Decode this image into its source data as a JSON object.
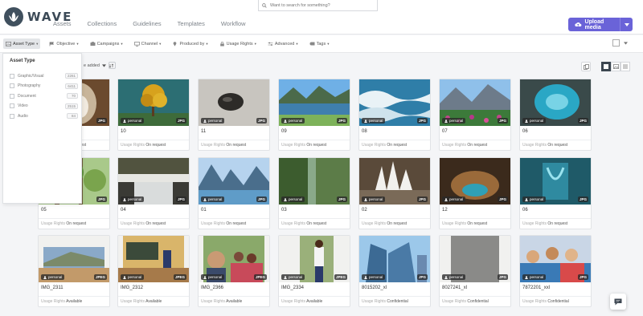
{
  "app": {
    "logo_text": "WAVE"
  },
  "nav": [
    "Assets",
    "Collections",
    "Guidelines",
    "Templates",
    "Workflow"
  ],
  "search": {
    "placeholder": "Want to search for something?"
  },
  "upload": {
    "label": "Upload media",
    "color": "#6a63d8"
  },
  "filters": [
    {
      "label": "Asset Type",
      "icon": "image-icon",
      "active": true
    },
    {
      "label": "Objective",
      "icon": "flag-icon"
    },
    {
      "label": "Campaigns",
      "icon": "campaign-icon"
    },
    {
      "label": "Channel",
      "icon": "monitor-icon"
    },
    {
      "label": "Produced by",
      "icon": "pin-icon"
    },
    {
      "label": "Usage Rights",
      "icon": "lock-icon"
    },
    {
      "label": "Advanced",
      "icon": "sliders-icon"
    },
    {
      "label": "Tags",
      "icon": "tag-icon"
    }
  ],
  "sort": {
    "label": "e added"
  },
  "asset_type_dropdown": {
    "title": "Asset Type",
    "items": [
      {
        "label": "Graphic/Visual",
        "count": "2261"
      },
      {
        "label": "Photography",
        "count": "6411"
      },
      {
        "label": "Document",
        "count": "70"
      },
      {
        "label": "Video",
        "count": "2515"
      },
      {
        "label": "Audio",
        "count": "84"
      }
    ]
  },
  "rights_label": "Usage Rights",
  "tag_label": "personal",
  "assets": [
    {
      "name": "",
      "format": "JPG",
      "rights": "On request",
      "thumb": "cave",
      "hidden": true
    },
    {
      "name": "10",
      "format": "JPG",
      "rights": "On request",
      "thumb": "tree"
    },
    {
      "name": "11",
      "format": "JPG",
      "rights": "On request",
      "thumb": "rock"
    },
    {
      "name": "09",
      "format": "JPG",
      "rights": "On request",
      "thumb": "lake"
    },
    {
      "name": "08",
      "format": "JPG",
      "rights": "On request",
      "thumb": "waves"
    },
    {
      "name": "07",
      "format": "JPG",
      "rights": "On request",
      "thumb": "flowers"
    },
    {
      "name": "06",
      "format": "JPG",
      "rights": "On request",
      "thumb": "pool"
    },
    {
      "name": "05",
      "format": "JPG",
      "rights": "On request",
      "thumb": "forest"
    },
    {
      "name": "04",
      "format": "JPG",
      "rights": "On request",
      "thumb": "falls"
    },
    {
      "name": "01",
      "format": "JPG",
      "rights": "On request",
      "thumb": "fjord"
    },
    {
      "name": "03",
      "format": "JPG",
      "rights": "On request",
      "thumb": "aerial"
    },
    {
      "name": "02",
      "format": "JPG",
      "rights": "On request",
      "thumb": "crystal"
    },
    {
      "name": "12",
      "format": "JPG",
      "rights": "On request",
      "thumb": "cavern"
    },
    {
      "name": "06",
      "format": "JPG",
      "rights": "On request",
      "thumb": "sculpture"
    },
    {
      "name": "IMG_2311",
      "format": "JPEG",
      "rights": "Available",
      "thumb": "school"
    },
    {
      "name": "IMG_2312",
      "format": "JPEG",
      "rights": "Available",
      "thumb": "classroom"
    },
    {
      "name": "IMG_2366",
      "format": "JPEG",
      "rights": "Available",
      "thumb": "selfie"
    },
    {
      "name": "IMG_2334",
      "format": "JPEG",
      "rights": "Available",
      "thumb": "man"
    },
    {
      "name": "8015202_xl",
      "format": "JPG",
      "rights": "Confidential",
      "thumb": "office"
    },
    {
      "name": "8027241_xl",
      "format": "JPG",
      "rights": "Confidential",
      "thumb": "texture"
    },
    {
      "name": "7872201_xxl",
      "format": "JPG",
      "rights": "Confidential",
      "thumb": "kids"
    }
  ]
}
